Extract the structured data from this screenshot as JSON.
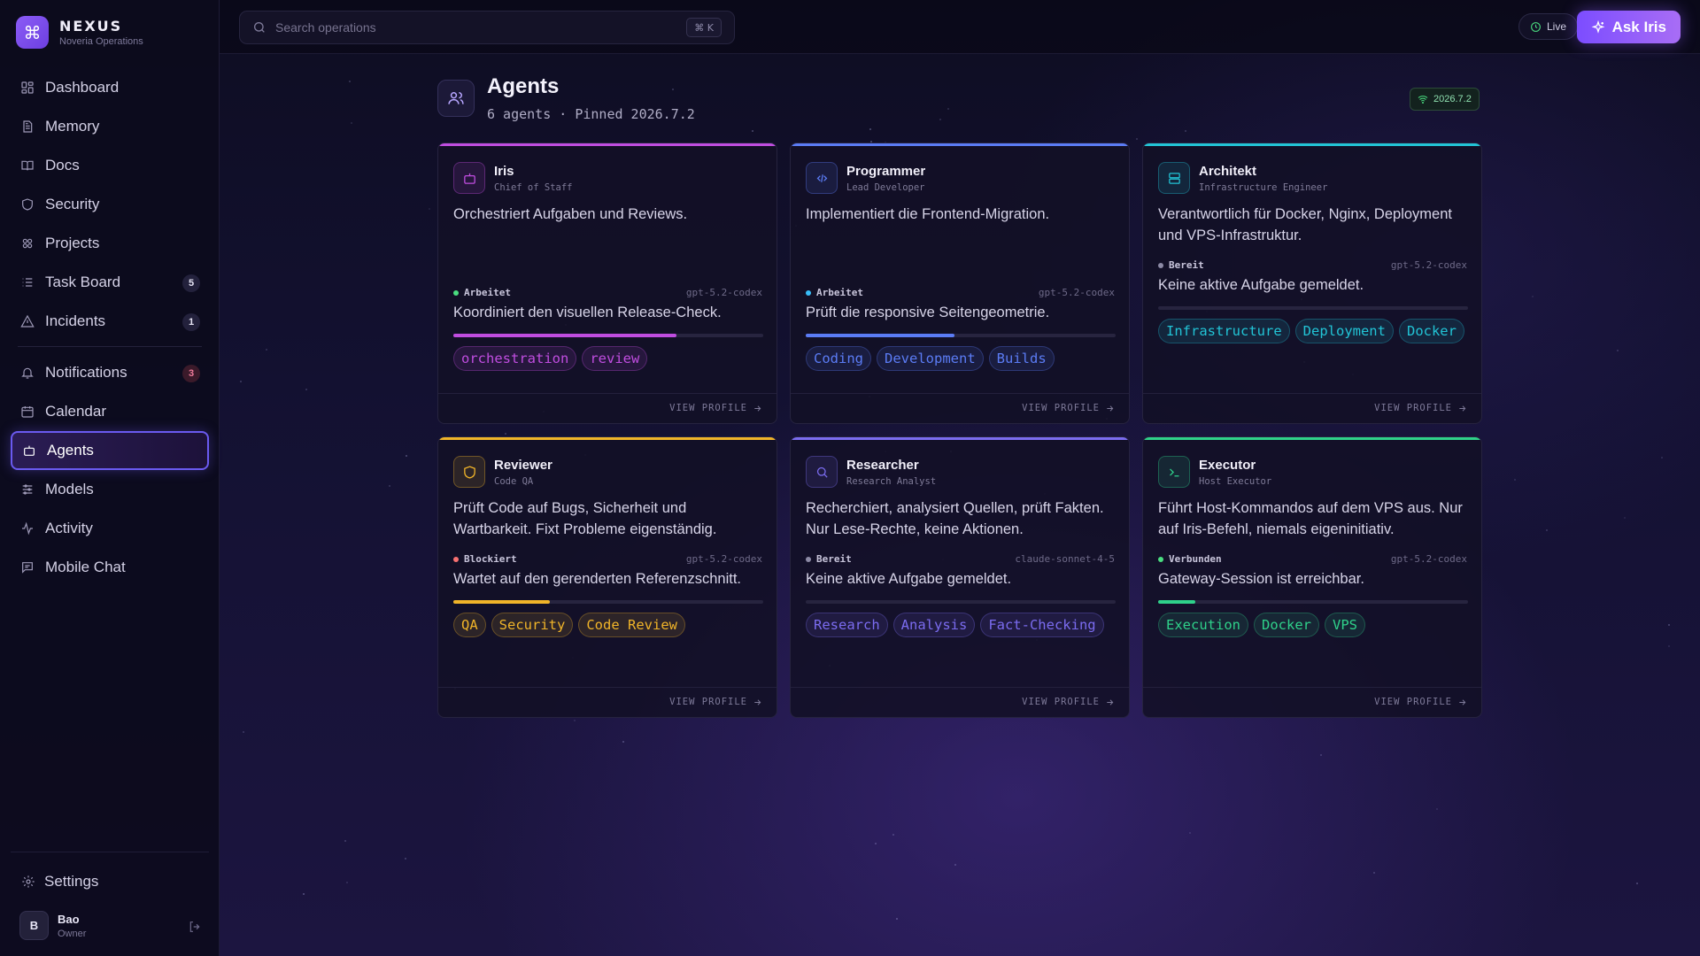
{
  "brand": {
    "name": "NEXUS",
    "subtitle": "Noveria Operations"
  },
  "sidebar": {
    "items": [
      {
        "label": "Dashboard",
        "icon": "dashboard-icon"
      },
      {
        "label": "Memory",
        "icon": "memory-icon"
      },
      {
        "label": "Docs",
        "icon": "book-icon"
      },
      {
        "label": "Security",
        "icon": "shield-icon"
      },
      {
        "label": "Projects",
        "icon": "projects-icon"
      },
      {
        "label": "Task Board",
        "icon": "list-icon",
        "badge": "5"
      },
      {
        "label": "Incidents",
        "icon": "warning-icon",
        "badge": "1"
      },
      {
        "label": "Notifications",
        "icon": "bell-icon",
        "badge": "3"
      },
      {
        "label": "Calendar",
        "icon": "calendar-icon"
      },
      {
        "label": "Agents",
        "icon": "bot-icon",
        "active": true
      },
      {
        "label": "Models",
        "icon": "sliders-icon"
      },
      {
        "label": "Activity",
        "icon": "activity-icon"
      },
      {
        "label": "Mobile Chat",
        "icon": "chat-icon"
      }
    ],
    "settings_label": "Settings",
    "user": {
      "initial": "B",
      "name": "Bao",
      "role": "Owner"
    }
  },
  "topbar": {
    "search_placeholder": "Search operations",
    "shortcut": "⌘ K",
    "live_label": "Live",
    "ask_label": "Ask Iris"
  },
  "page": {
    "title": "Agents",
    "subtitle": "6 agents · Pinned 2026.7.2",
    "version": "2026.7.2"
  },
  "view_profile_label": "VIEW PROFILE",
  "agents": [
    {
      "name": "Iris",
      "role": "Chief of Staff",
      "accent": "#c04de0",
      "icon": "bot-icon",
      "description": "Orchestriert Aufgaben und Reviews.",
      "status": "Arbeitet",
      "status_color": "#4ade80",
      "model": "gpt-5.2-codex",
      "task": "Koordiniert den visuellen Release-Check.",
      "progress": 0.72,
      "tags": [
        "orchestration",
        "review"
      ]
    },
    {
      "name": "Programmer",
      "role": "Lead Developer",
      "accent": "#5b7cf5",
      "icon": "code-icon",
      "description": "Implementiert die Frontend-Migration.",
      "status": "Arbeitet",
      "status_color": "#38bdf8",
      "model": "gpt-5.2-codex",
      "task": "Prüft die responsive Seitengeometrie.",
      "progress": 0.48,
      "tags": [
        "Coding",
        "Development",
        "Builds"
      ]
    },
    {
      "name": "Architekt",
      "role": "Infrastructure Engineer",
      "accent": "#22c4d6",
      "icon": "server-icon",
      "description": "Verantwortlich für Docker, Nginx, Deployment und VPS-Infrastruktur.",
      "status": "Bereit",
      "status_color": "#8c8aa5",
      "model": "gpt-5.2-codex",
      "task": "Keine aktive Aufgabe gemeldet.",
      "progress": 0,
      "tags": [
        "Infrastructure",
        "Deployment",
        "Docker"
      ]
    },
    {
      "name": "Reviewer",
      "role": "Code QA",
      "accent": "#f0b429",
      "icon": "shield-icon",
      "description": "Prüft Code auf Bugs, Sicherheit und Wartbarkeit. Fixt Probleme eigenständig.",
      "status": "Blockiert",
      "status_color": "#f87171",
      "model": "gpt-5.2-codex",
      "task": "Wartet auf den gerenderten Referenzschnitt.",
      "progress": 0.31,
      "tags": [
        "QA",
        "Security",
        "Code Review"
      ]
    },
    {
      "name": "Researcher",
      "role": "Research Analyst",
      "accent": "#7b6cf0",
      "icon": "search-icon",
      "description": "Recherchiert, analysiert Quellen, prüft Fakten. Nur Lese-Rechte, keine Aktionen.",
      "status": "Bereit",
      "status_color": "#8c8aa5",
      "model": "claude-sonnet-4-5",
      "task": "Keine aktive Aufgabe gemeldet.",
      "progress": 0,
      "tags": [
        "Research",
        "Analysis",
        "Fact-Checking"
      ]
    },
    {
      "name": "Executor",
      "role": "Host Executor",
      "accent": "#2fd18a",
      "icon": "terminal-icon",
      "description": "Führt Host-Kommandos auf dem VPS aus. Nur auf Iris-Befehl, niemals eigeninitiativ.",
      "status": "Verbunden",
      "status_color": "#4ade80",
      "model": "gpt-5.2-codex",
      "task": "Gateway-Session ist erreichbar.",
      "progress": 0.12,
      "tags": [
        "Execution",
        "Docker",
        "VPS"
      ]
    }
  ]
}
